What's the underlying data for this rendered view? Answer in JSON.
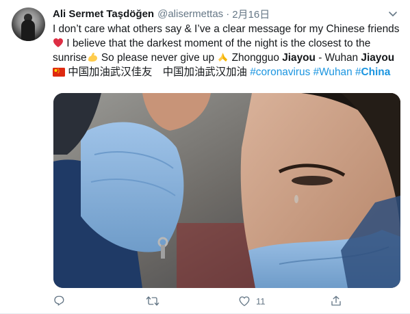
{
  "tweet": {
    "author_name": "Ali Sermet Taşdöğen",
    "handle": "@alisermettas",
    "separator": "·",
    "date": "2月16日",
    "text": {
      "t1": "I don’t care what others say & I’ve a clear message for my Chinese friends ",
      "t2": " I believe that the darkest moment of the night is the closest to the sunrise",
      "t3": " So please never give up ",
      "t4": " Zhongguo ",
      "b1": "Jiayou",
      "t5": " - Wuhan ",
      "b2": "Jiayou",
      "t6": " ",
      "t7": " 中国加油武汉佳友　中国加油武汉加油 ",
      "hashtag_coronavirus": "#coronavirus",
      "hashtag_wuhan": "#Wuhan",
      "hashtag_china_prefix": "#",
      "hashtag_china": "China"
    },
    "actions": {
      "reply_count": "",
      "retweet_count": "",
      "like_count": "11"
    }
  },
  "icons": [
    "red-heart-icon",
    "flexed-biceps-icon",
    "folded-hands-icon",
    "china-flag-icon",
    "reply-icon",
    "retweet-icon",
    "like-icon",
    "share-icon",
    "chevron-down-icon"
  ],
  "colors": {
    "link": "#1b95e0",
    "secondary": "#657786",
    "text": "#14171a"
  }
}
